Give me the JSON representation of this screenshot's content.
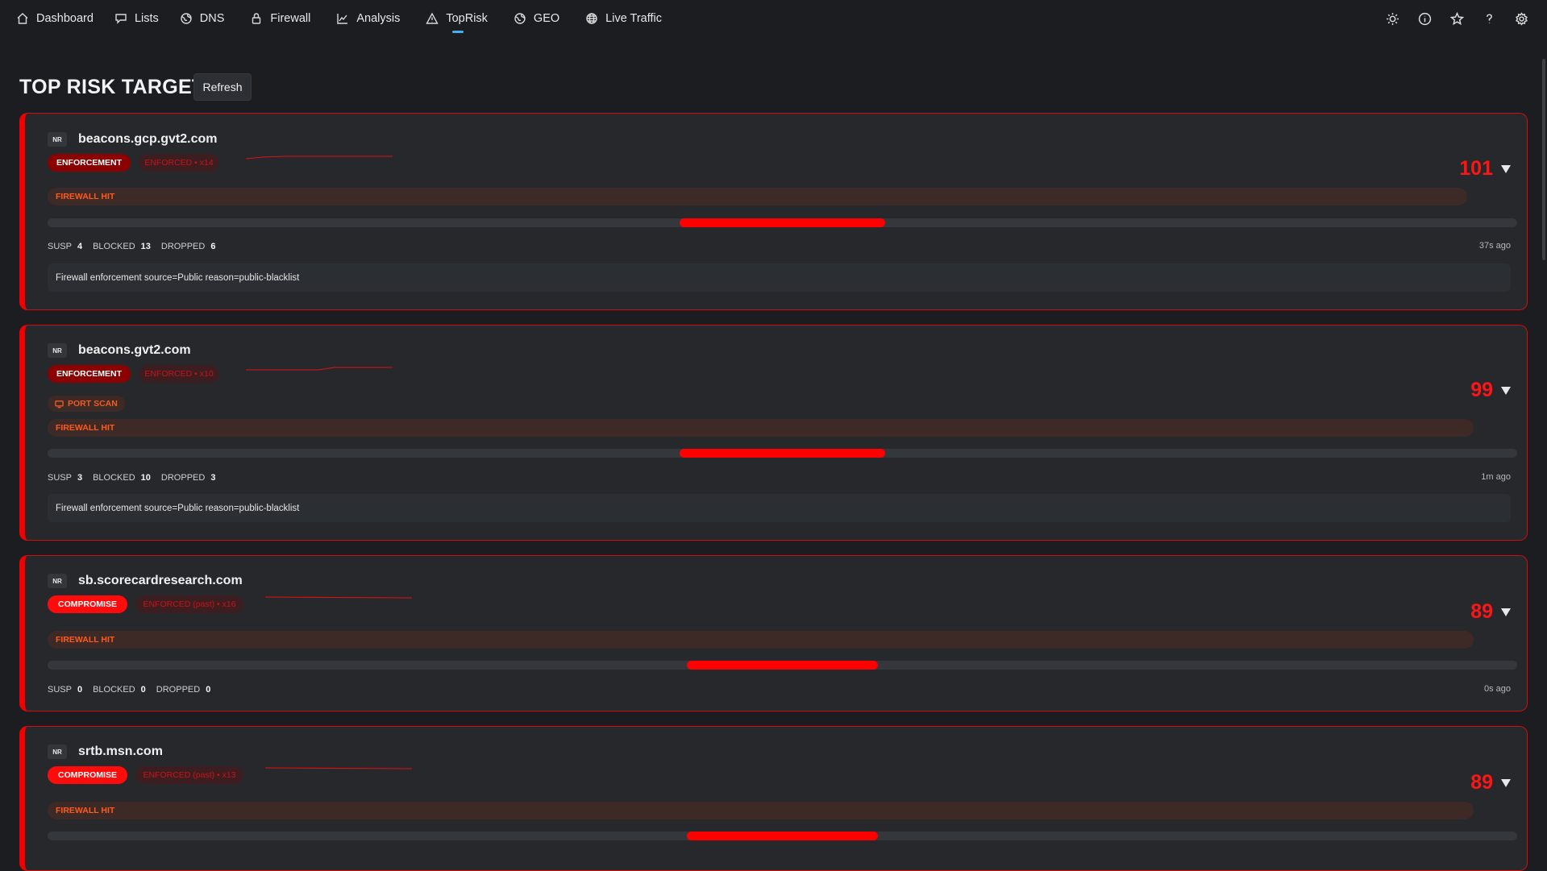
{
  "nav": {
    "items": [
      {
        "label": "Dashboard",
        "icon": "home-icon"
      },
      {
        "label": "Lists",
        "icon": "comment-icon"
      },
      {
        "label": "DNS",
        "icon": "globe-icon"
      },
      {
        "label": "Firewall",
        "icon": "lock-icon"
      },
      {
        "label": "Analysis",
        "icon": "chart-icon"
      },
      {
        "label": "TopRisk",
        "icon": "warning-icon",
        "active": true
      },
      {
        "label": "GEO",
        "icon": "globe-icon"
      },
      {
        "label": "Live Traffic",
        "icon": "world-icon"
      }
    ],
    "right_icons": [
      "sun-icon",
      "info-icon",
      "star-icon",
      "help-icon",
      "settings-icon"
    ],
    "active_color": "#3fb2f2"
  },
  "page": {
    "title": "TOP RISK TARGETS",
    "refresh_label": "Refresh"
  },
  "colors": {
    "accent_red": "#ff0000",
    "enforcement": "#8b0000",
    "compromise": "#ff0b0b",
    "firewall_hit": "#ff5a1c"
  },
  "targets": [
    {
      "badge": "NR",
      "domain": "beacons.gcp.gvt2.com",
      "status": "ENFORCEMENT",
      "enforced": "ENFORCED • x14",
      "score": "101",
      "tags": [
        "FIREWALL HIT"
      ],
      "risk_fill": 0.14,
      "stats": [
        {
          "label": "SUSP",
          "value": "4"
        },
        {
          "label": "BLOCKED",
          "value": "13"
        },
        {
          "label": "DROPPED",
          "value": "6"
        }
      ],
      "ago": "37s ago",
      "reason": "Firewall enforcement source=Public reason=public-blacklist"
    },
    {
      "badge": "NR",
      "domain": "beacons.gvt2.com",
      "status": "ENFORCEMENT",
      "enforced": "ENFORCED • x10",
      "score": "99",
      "port_scan": "PORT SCAN",
      "tags": [
        "FIREWALL HIT"
      ],
      "risk_fill": 0.14,
      "stats": [
        {
          "label": "SUSP",
          "value": "3"
        },
        {
          "label": "BLOCKED",
          "value": "10"
        },
        {
          "label": "DROPPED",
          "value": "3"
        }
      ],
      "ago": "1m ago",
      "reason": "Firewall enforcement source=Public reason=public-blacklist"
    },
    {
      "badge": "NR",
      "domain": "sb.scorecardresearch.com",
      "status": "COMPROMISE",
      "enforced": "ENFORCED (past) • x16",
      "score": "89",
      "tags": [
        "FIREWALL HIT"
      ],
      "risk_fill": 0.13,
      "stats": [
        {
          "label": "SUSP",
          "value": "0"
        },
        {
          "label": "BLOCKED",
          "value": "0"
        },
        {
          "label": "DROPPED",
          "value": "0"
        }
      ],
      "ago": "0s ago"
    },
    {
      "badge": "NR",
      "domain": "srtb.msn.com",
      "status": "COMPROMISE",
      "enforced": "ENFORCED (past) • x13",
      "score": "89",
      "tags": [
        "FIREWALL HIT"
      ],
      "risk_fill": 0.13
    }
  ]
}
